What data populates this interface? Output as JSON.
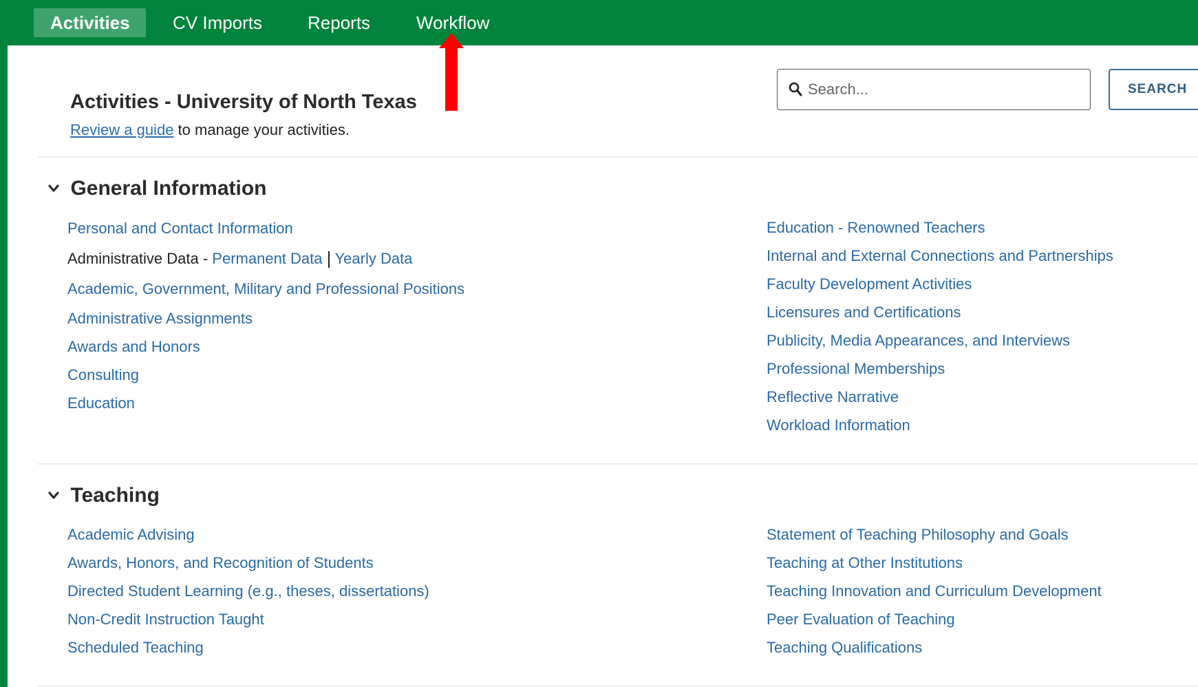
{
  "nav": {
    "tabs": [
      {
        "label": "Activities",
        "active": true
      },
      {
        "label": "CV Imports",
        "active": false
      },
      {
        "label": "Reports",
        "active": false
      },
      {
        "label": "Workflow",
        "active": false
      }
    ]
  },
  "colors": {
    "brand_green": "#00843d",
    "link_blue": "#2a6aa6",
    "annotation_arrow": "#ff0000"
  },
  "header": {
    "title": "Activities - University of North Texas",
    "guide_link": "Review a guide",
    "guide_text": " to manage your activities."
  },
  "search": {
    "placeholder": "Search...",
    "icon": "search-icon",
    "button_label": "SEARCH"
  },
  "sections": {
    "general": {
      "title": "General Information",
      "left": {
        "personal": "Personal and Contact Information",
        "admin_data_label": "Administrative Data - ",
        "permanent_data": "Permanent Data",
        "yearly_data": "Yearly Data",
        "positions": "Academic, Government, Military and Professional Positions",
        "assignments": "Administrative Assignments",
        "awards": "Awards and Honors",
        "consulting": "Consulting",
        "education": "Education"
      },
      "right": [
        "Education - Renowned Teachers",
        "Internal and External Connections and Partnerships",
        "Faculty Development Activities",
        "Licensures and Certifications",
        "Publicity, Media Appearances, and Interviews",
        "Professional Memberships",
        "Reflective Narrative",
        "Workload Information"
      ]
    },
    "teaching": {
      "title": "Teaching",
      "left": [
        "Academic Advising",
        "Awards, Honors, and Recognition of Students",
        "Directed Student Learning (e.g., theses, dissertations)",
        "Non-Credit Instruction Taught",
        "Scheduled Teaching"
      ],
      "right": [
        "Statement of Teaching Philosophy and Goals",
        "Teaching at Other Institutions",
        "Teaching Innovation and Curriculum Development",
        "Peer Evaluation of Teaching",
        "Teaching Qualifications"
      ]
    }
  }
}
